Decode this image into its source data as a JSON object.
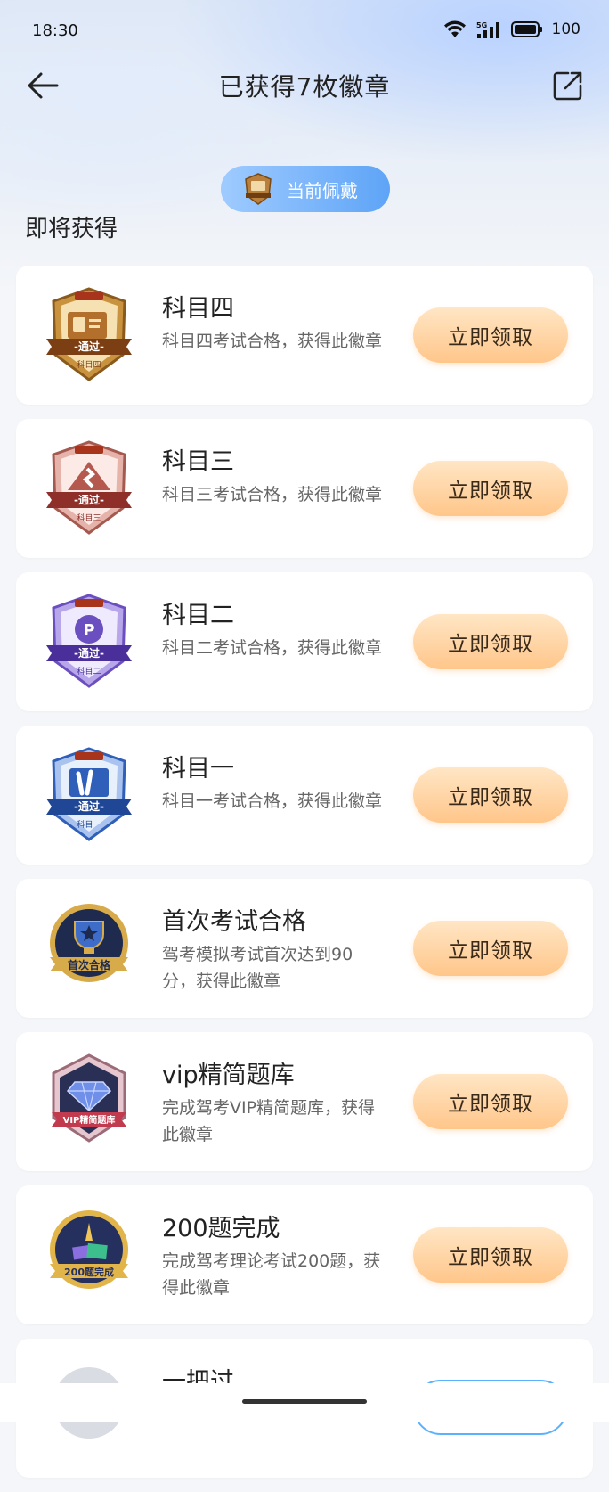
{
  "status_bar": {
    "time": "18:30",
    "network": "5G",
    "battery": "100"
  },
  "header": {
    "title": "已获得7枚徽章"
  },
  "wearing_pill": {
    "label": "当前佩戴"
  },
  "section": {
    "title": "即将获得"
  },
  "colors": {
    "accent": "#5ea4f7",
    "claim_start": "#ffe6c5",
    "claim_end": "#ffc68a"
  },
  "badges": [
    {
      "title": "科目四",
      "desc": "科目四考试合格，获得此徽章",
      "button": "立即领取",
      "badge_text": "-通过-",
      "badge_sub": "科目四",
      "icon": "license-card-badge-icon"
    },
    {
      "title": "科目三",
      "desc": "科目三考试合格，获得此徽章",
      "button": "立即领取",
      "badge_text": "-通过-",
      "badge_sub": "科目三",
      "icon": "road-badge-icon"
    },
    {
      "title": "科目二",
      "desc": "科目二考试合格，获得此徽章",
      "button": "立即领取",
      "badge_text": "-通过-",
      "badge_sub": "科目二",
      "icon": "parking-badge-icon"
    },
    {
      "title": "科目一",
      "desc": "科目一考试合格，获得此徽章",
      "button": "立即领取",
      "badge_text": "-通过-",
      "badge_sub": "科目一",
      "icon": "victory-hand-badge-icon"
    },
    {
      "title": "首次考试合格",
      "desc": "驾考模拟考试首次达到90分，获得此徽章",
      "button": "立即领取",
      "badge_text": "首次合格",
      "icon": "trophy-badge-icon"
    },
    {
      "title": "vip精简题库",
      "desc": "完成驾考VIP精简题库，获得此徽章",
      "button": "立即领取",
      "badge_text": "VIP精简题库",
      "icon": "diamond-badge-icon"
    },
    {
      "title": "200题完成",
      "desc": "完成驾考理论考试200题，获得此徽章",
      "button": "立即领取",
      "badge_text": "200题完成",
      "icon": "books-badge-icon"
    },
    {
      "title": "一把过"
    }
  ]
}
